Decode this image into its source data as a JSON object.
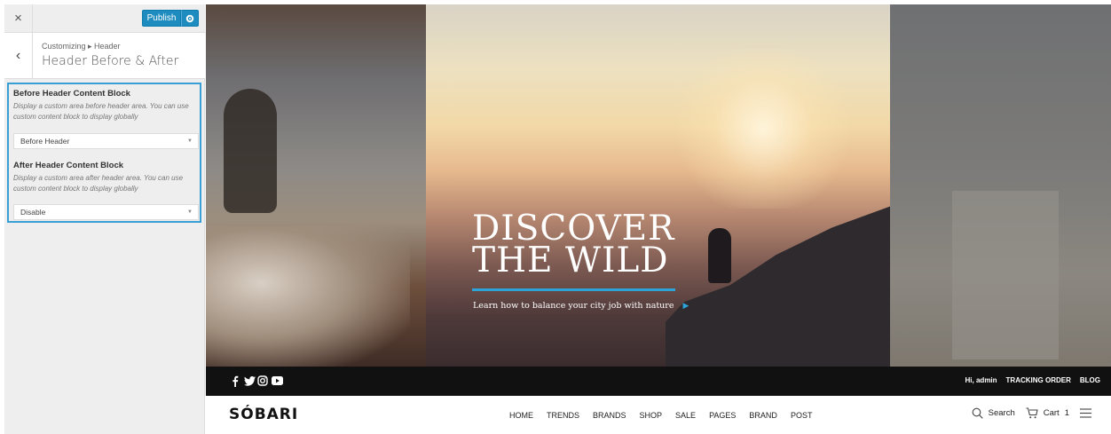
{
  "customizer": {
    "close_icon": "×",
    "publish_label": "Publish",
    "breadcrumb": "Customizing ▸ Header",
    "back_icon": "‹",
    "section_title": "Header Before & After",
    "controls": [
      {
        "title": "Before Header Content Block",
        "description": "Display a custom area before header area. You can use custom content block to display globally",
        "selected": "Before Header"
      },
      {
        "title": "After Header Content Block",
        "description": "Display a custom area after header area. You can use custom content block to display globally",
        "selected": "Disable"
      }
    ],
    "accent_color": "#1e8cbe",
    "focus_color": "#39a0d5"
  },
  "hero": {
    "title_line1": "DISCOVER",
    "title_line2": "THE WILD",
    "subtitle": "Learn how to balance your city job with nature",
    "accent_color": "#2da3d8"
  },
  "topbar": {
    "social_icons": [
      "facebook-icon",
      "twitter-icon",
      "instagram-icon",
      "youtube-icon"
    ],
    "links": [
      "Hi, admin",
      "TRACKING ORDER",
      "BLOG"
    ]
  },
  "nav": {
    "logo": "SÓBARI",
    "menu": [
      "HOME",
      "TRENDS",
      "BRANDS",
      "SHOP",
      "SALE",
      "PAGES",
      "BRAND",
      "POST"
    ],
    "search_label": "Search",
    "cart_label": "Cart",
    "cart_count": "1"
  }
}
